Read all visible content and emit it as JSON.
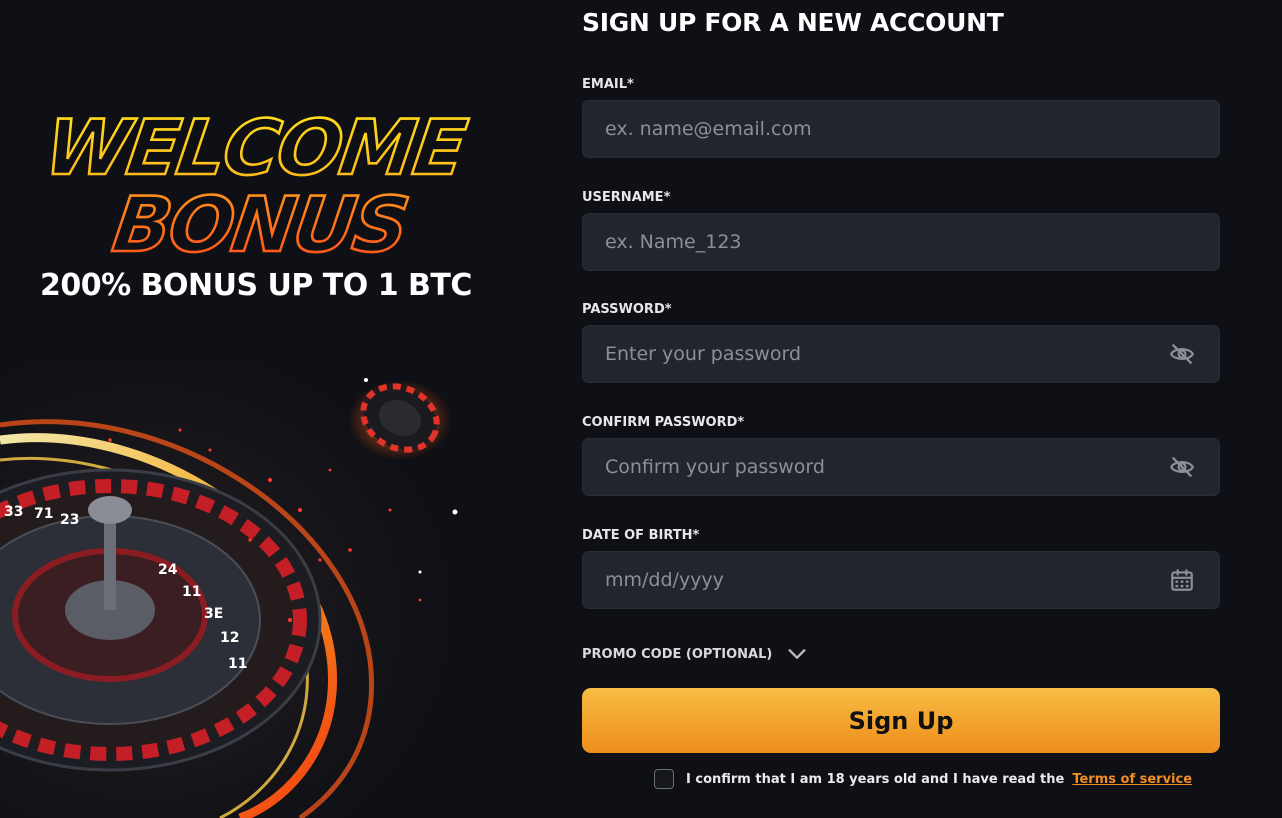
{
  "promo": {
    "headline_line1": "WELCOME",
    "headline_line2": "BONUS",
    "bonus_text": "200% BONUS UP TO 1 BTC",
    "roulette_numbers": [
      "33",
      "71",
      "23",
      "24",
      "11",
      "3E",
      "12",
      "11"
    ],
    "colors": {
      "headline_outline_top": "#ffd21a",
      "headline_outline_bottom": "#ff5a1a",
      "accent_red": "#d8232a"
    }
  },
  "form": {
    "title": "SIGN UP FOR A NEW ACCOUNT",
    "email": {
      "label": "EMAIL*",
      "placeholder": "ex. name@email.com",
      "value": ""
    },
    "username": {
      "label": "USERNAME*",
      "placeholder": "ex. Name_123",
      "value": ""
    },
    "password": {
      "label": "PASSWORD*",
      "placeholder": "Enter your password",
      "value": "",
      "icon": "eye-slash-icon"
    },
    "confirm_password": {
      "label": "CONFIRM PASSWORD*",
      "placeholder": "Confirm your password",
      "value": "",
      "icon": "eye-slash-icon"
    },
    "date_of_birth": {
      "label": "DATE OF BIRTH*",
      "placeholder": "mm/dd/yyyy",
      "value": "",
      "icon": "calendar-icon"
    },
    "promo_code": {
      "label": "PROMO CODE (OPTIONAL)",
      "icon": "chevron-down-icon",
      "expanded": false
    },
    "submit_label": "Sign Up",
    "confirm": {
      "text": "I confirm that I am 18 years old and I have read the",
      "link": "Terms of service",
      "checked": false
    },
    "colors": {
      "field_bg": "#22252e",
      "button_top": "#f7be45",
      "button_bottom": "#ee8f1e",
      "link": "#f28d23"
    }
  }
}
